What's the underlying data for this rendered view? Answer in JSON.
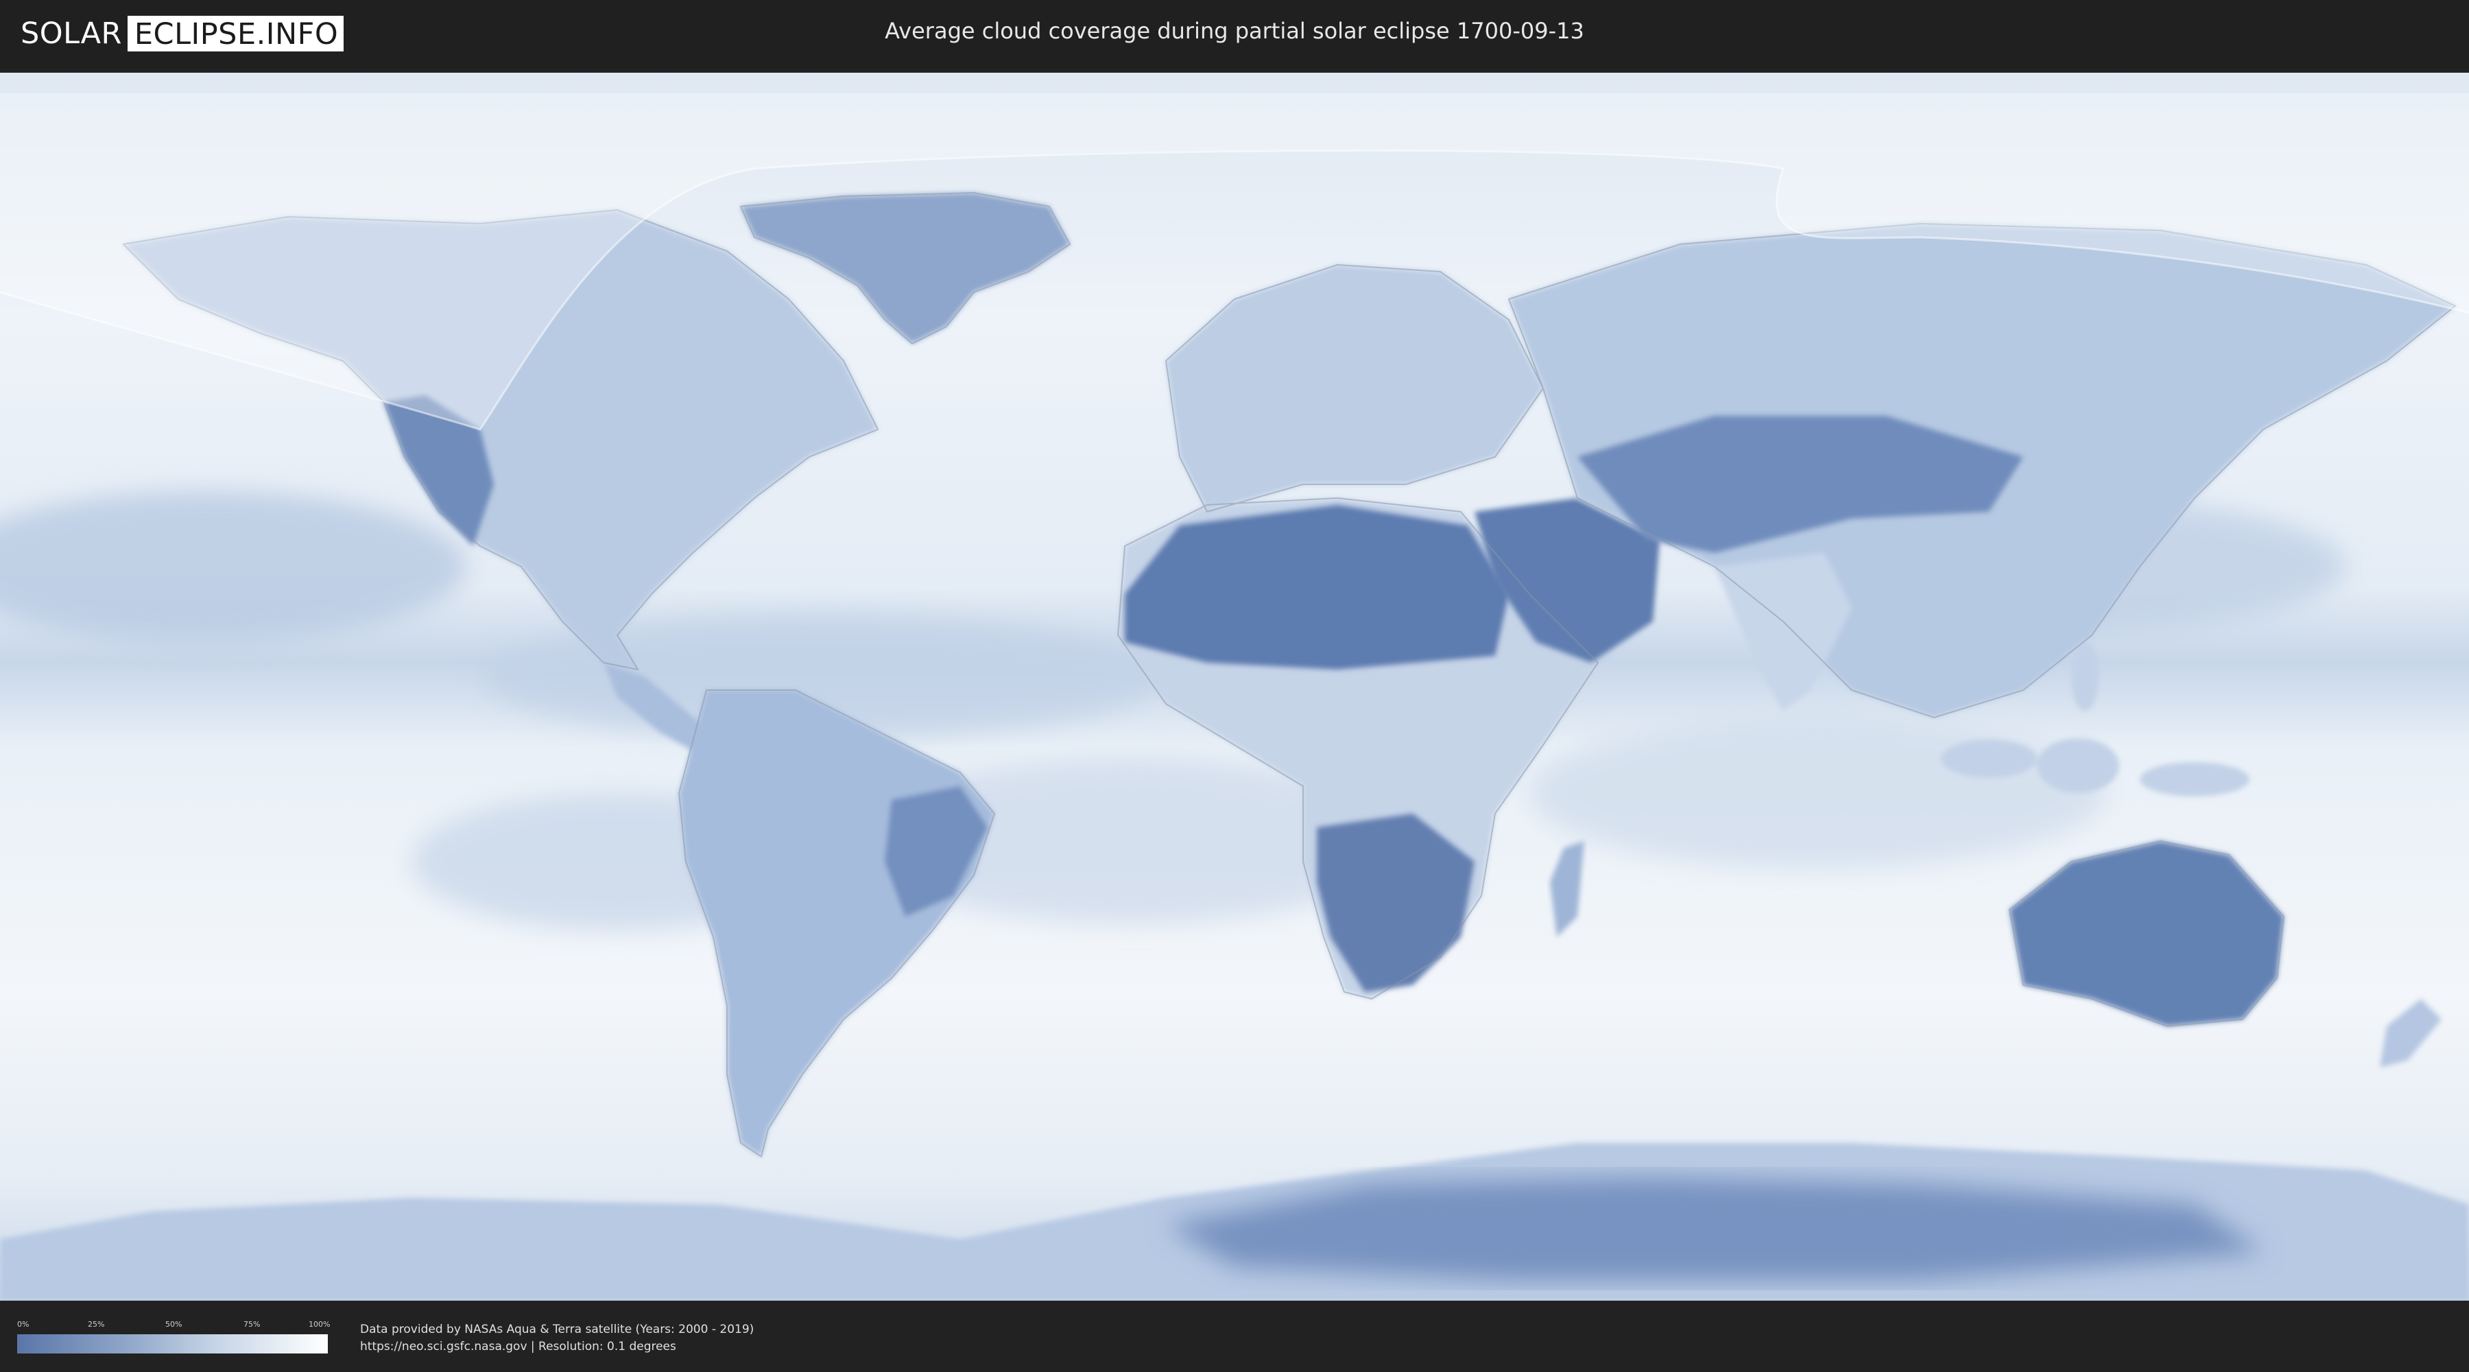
{
  "header": {
    "logo_left": "SOLAR",
    "logo_right": "ECLIPSE.INFO",
    "title": "Average cloud coverage during partial solar eclipse 1700-09-13"
  },
  "legend": {
    "ticks": [
      "0%",
      "25%",
      "50%",
      "75%",
      "100%"
    ],
    "low_color": "#5a76a8",
    "high_color": "#ffffff"
  },
  "footer": {
    "credit_line1": "Data provided by NASAs Aqua & Terra satellite (Years: 2000 - 2019)",
    "credit_line2": "https://neo.sci.gsfc.nasa.gov | Resolution: 0.1 degrees"
  },
  "colors": {
    "ocean_cloudy": "#eef3f9",
    "land_clear": "#5f7eb0",
    "eclipse_zone": "rgba(255,255,255,0.35)"
  }
}
